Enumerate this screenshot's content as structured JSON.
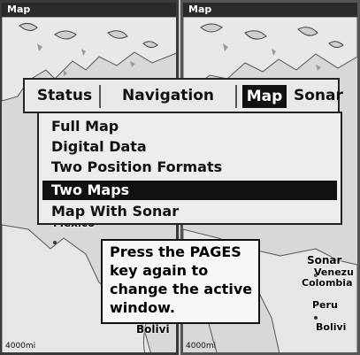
{
  "panes": {
    "left": {
      "title": "Map",
      "scale": "4000mi",
      "places": [
        "Mexico",
        "Bolivi"
      ]
    },
    "right": {
      "title": "Map",
      "scale": "4000mi",
      "places": [
        "Sonar",
        "Venezu",
        "Colombia",
        "Peru",
        "Bolivi"
      ]
    }
  },
  "tabs": [
    {
      "label": "Status",
      "active": false
    },
    {
      "label": "Navigation",
      "active": false
    },
    {
      "label": "Map",
      "active": true
    },
    {
      "label": "Sonar",
      "active": false
    }
  ],
  "menu": {
    "items": [
      {
        "label": "Full Map",
        "selected": false
      },
      {
        "label": "Digital Data",
        "selected": false
      },
      {
        "label": "Two Position Formats",
        "selected": false
      },
      {
        "label": "Two Maps",
        "selected": true
      },
      {
        "label": "Map With Sonar",
        "selected": false
      }
    ]
  },
  "callout": {
    "lines": [
      "Press the PAGES",
      "key again to",
      "change the active",
      "window."
    ]
  },
  "colors": {
    "highlight": "#111111",
    "background": "#e9e9e9"
  }
}
